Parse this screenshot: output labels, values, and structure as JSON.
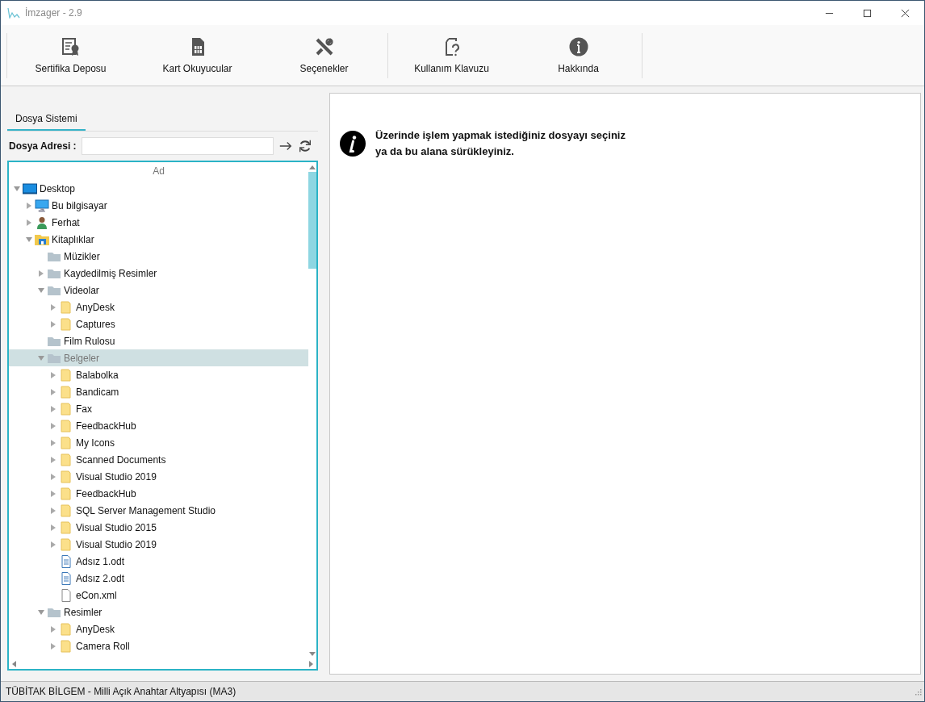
{
  "window": {
    "title": "İmzager - 2.9"
  },
  "toolbar": {
    "groups": [
      [
        {
          "label": "Sertifika Deposu"
        },
        {
          "label": "Kart Okuyucular"
        },
        {
          "label": "Seçenekler"
        }
      ],
      [
        {
          "label": "Kullanım Klavuzu"
        },
        {
          "label": "Hakkında"
        }
      ]
    ]
  },
  "tabs": [
    {
      "label": "Dosya Sistemi",
      "selected": true
    }
  ],
  "address": {
    "label": "Dosya Adresi :"
  },
  "tree": {
    "column": "Ad",
    "items": [
      {
        "label": "Desktop",
        "kind": "desktop",
        "expandable": true,
        "expanded": true,
        "selected": false,
        "children": [
          {
            "label": "Bu bilgisayar",
            "kind": "computer",
            "expandable": true,
            "expanded": false,
            "selected": false
          },
          {
            "label": "Ferhat",
            "kind": "user",
            "expandable": true,
            "expanded": false,
            "selected": false
          },
          {
            "label": "Kitaplıklar",
            "kind": "library",
            "expandable": true,
            "expanded": true,
            "selected": false,
            "children": [
              {
                "label": "Müzikler",
                "kind": "gray-folder",
                "expandable": false,
                "selected": false
              },
              {
                "label": "Kaydedilmiş Resimler",
                "kind": "gray-folder",
                "expandable": true,
                "expanded": false,
                "selected": false
              },
              {
                "label": "Videolar",
                "kind": "gray-folder",
                "expandable": true,
                "expanded": true,
                "selected": false,
                "children": [
                  {
                    "label": "AnyDesk",
                    "kind": "folder",
                    "expandable": true,
                    "expanded": false,
                    "selected": false
                  },
                  {
                    "label": "Captures",
                    "kind": "folder",
                    "expandable": true,
                    "expanded": false,
                    "selected": false
                  }
                ]
              },
              {
                "label": "Film Rulosu",
                "kind": "gray-folder",
                "expandable": false,
                "selected": false
              },
              {
                "label": "Belgeler",
                "kind": "gray-folder",
                "expandable": true,
                "expanded": true,
                "selected": true,
                "children": [
                  {
                    "label": "Balabolka",
                    "kind": "folder",
                    "expandable": true,
                    "expanded": false,
                    "selected": false
                  },
                  {
                    "label": "Bandicam",
                    "kind": "folder",
                    "expandable": true,
                    "expanded": false,
                    "selected": false
                  },
                  {
                    "label": "Fax",
                    "kind": "folder",
                    "expandable": true,
                    "expanded": false,
                    "selected": false
                  },
                  {
                    "label": "FeedbackHub",
                    "kind": "folder",
                    "expandable": true,
                    "expanded": false,
                    "selected": false
                  },
                  {
                    "label": "My Icons",
                    "kind": "folder",
                    "expandable": true,
                    "expanded": false,
                    "selected": false
                  },
                  {
                    "label": "Scanned Documents",
                    "kind": "folder",
                    "expandable": true,
                    "expanded": false,
                    "selected": false
                  },
                  {
                    "label": "Visual Studio 2019",
                    "kind": "folder",
                    "expandable": true,
                    "expanded": false,
                    "selected": false
                  },
                  {
                    "label": "FeedbackHub",
                    "kind": "folder",
                    "expandable": true,
                    "expanded": false,
                    "selected": false
                  },
                  {
                    "label": "SQL Server Management Studio",
                    "kind": "folder",
                    "expandable": true,
                    "expanded": false,
                    "selected": false
                  },
                  {
                    "label": "Visual Studio 2015",
                    "kind": "folder",
                    "expandable": true,
                    "expanded": false,
                    "selected": false
                  },
                  {
                    "label": "Visual Studio 2019",
                    "kind": "folder",
                    "expandable": true,
                    "expanded": false,
                    "selected": false
                  },
                  {
                    "label": "Adsız 1.odt",
                    "kind": "document",
                    "expandable": false,
                    "selected": false
                  },
                  {
                    "label": "Adsız 2.odt",
                    "kind": "document",
                    "expandable": false,
                    "selected": false
                  },
                  {
                    "label": "eCon.xml",
                    "kind": "file",
                    "expandable": false,
                    "selected": false
                  }
                ]
              },
              {
                "label": "Resimler",
                "kind": "gray-folder",
                "expandable": true,
                "expanded": true,
                "selected": false,
                "children": [
                  {
                    "label": "AnyDesk",
                    "kind": "folder",
                    "expandable": true,
                    "expanded": false,
                    "selected": false
                  },
                  {
                    "label": "Camera Roll",
                    "kind": "folder",
                    "expandable": true,
                    "expanded": false,
                    "selected": false
                  }
                ]
              }
            ]
          }
        ]
      }
    ]
  },
  "message": {
    "lines": [
      "Üzerinde işlem yapmak istediğiniz dosyayı seçiniz",
      "ya da bu alana sürükleyiniz."
    ]
  },
  "status_bar": {
    "text": "TÜBİTAK BİLGEM - Milli Açık Anahtar Altyapısı (MA3)"
  }
}
